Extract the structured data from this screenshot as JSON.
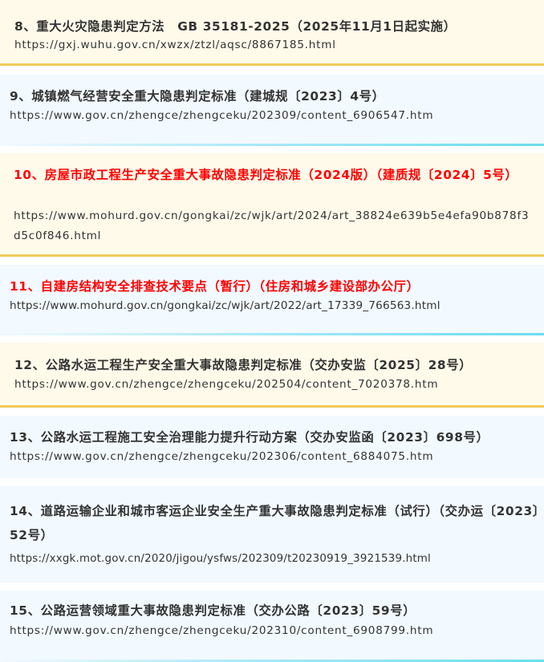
{
  "items": [
    {
      "title": "8、重大火灾隐患判定方法　GB 35181-2025（2025年11月1日起实施）",
      "url": "https://gxj.wuhu.gov.cn/xwzx/ztzl/aqsc/8867185.html"
    },
    {
      "title": "9、城镇燃气经营安全重大隐患判定标准（建城规〔2023〕4号）",
      "url": "https://www.gov.cn/zhengce/zhengceku/202309/content_6906547.htm"
    },
    {
      "title": "10、房屋市政工程生产安全重大事故隐患判定标准（2024版）（建质规〔2024〕5号）",
      "url": "https://www.mohurd.gov.cn/gongkai/zc/wjk/art/2024/art_38824e639b5e4efa90b878f3d5c0f846.html"
    },
    {
      "title": "11、自建房结构安全排查技术要点（暂行）（住房和城乡建设部办公厅）",
      "url": "https://www.mohurd.gov.cn/gongkai/zc/wjk/art/2022/art_17339_766563.html"
    },
    {
      "title": "12、公路水运工程生产安全重大事故隐患判定标准（交办安监〔2025〕28号）",
      "url": "https://www.gov.cn/zhengce/zhengceku/202504/content_7020378.htm"
    },
    {
      "title": "13、公路水运工程施工安全治理能力提升行动方案（交办安监函〔2023〕698号）",
      "url": "https://www.gov.cn/zhengce/zhengceku/202306/content_6884075.htm"
    },
    {
      "title": "14、道路运输企业和城市客运企业安全生产重大事故隐患判定标准（试行）（交办运〔2023〕52号）",
      "url": "https://xxgk.mot.gov.cn/2020/jigou/ysfws/202309/t20230919_3921539.html"
    },
    {
      "title": "15、公路运营领域重大事故隐患判定标准（交办公路〔2023〕59号）",
      "url": "https://www.gov.cn/zhengce/zhengceku/202310/content_6908799.htm"
    }
  ],
  "colors": {
    "text": "#333333",
    "highlight_red": "#ff0000",
    "yellow_bg": "#fffaea",
    "yellow_bar": "#f1ca59",
    "blue_bg": "#f2f9ff",
    "blue_bar": "#6ddcef"
  }
}
